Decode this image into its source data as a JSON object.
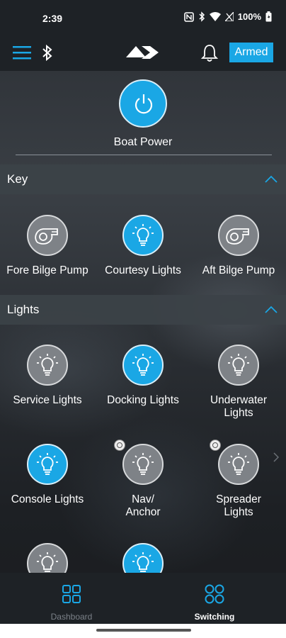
{
  "status_bar": {
    "time": "2:39",
    "battery": "100%"
  },
  "app_bar": {
    "armed_label": "Armed"
  },
  "power": {
    "label": "Boat Power",
    "state": "on"
  },
  "sections": [
    {
      "title": "Key",
      "expanded": true,
      "tiles": [
        {
          "label": "Fore Bilge Pump",
          "icon": "pump-icon",
          "on": false
        },
        {
          "label": "Courtesy Lights",
          "icon": "bulb-icon",
          "on": true
        },
        {
          "label": "Aft Bilge Pump",
          "icon": "pump-icon",
          "on": false
        }
      ]
    },
    {
      "title": "Lights",
      "expanded": true,
      "tiles": [
        {
          "label": "Service Lights",
          "icon": "bulb-icon",
          "on": false
        },
        {
          "label": "Docking Lights",
          "icon": "bulb-icon",
          "on": true
        },
        {
          "label": "Underwater Lights",
          "icon": "bulb-icon",
          "on": false
        },
        {
          "label": "Console Lights",
          "icon": "bulb-icon",
          "on": true
        },
        {
          "label": "Nav/ Anchor",
          "icon": "bulb-icon",
          "on": false,
          "badge": true
        },
        {
          "label": "Spreader Lights",
          "icon": "bulb-icon",
          "on": false,
          "badge": true
        },
        {
          "label": "",
          "icon": "bulb-icon",
          "on": false
        },
        {
          "label": "",
          "icon": "bulb-icon",
          "on": true
        }
      ]
    }
  ],
  "bottom_nav": [
    {
      "label": "Dashboard",
      "active": false
    },
    {
      "label": "Switching",
      "active": true
    }
  ],
  "colors": {
    "accent": "#1aa7e5",
    "tile_off": "#7e8287",
    "bar_bg": "#1e2226"
  }
}
